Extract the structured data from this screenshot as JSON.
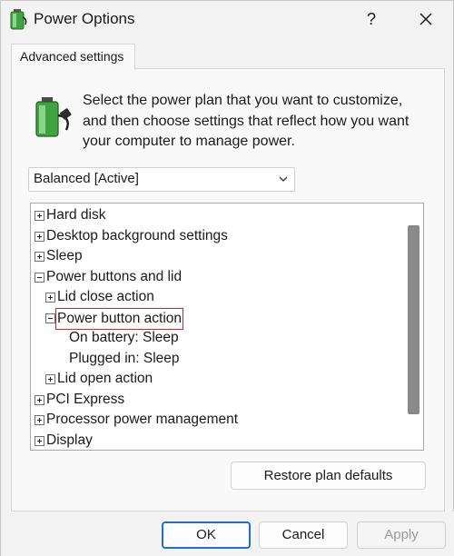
{
  "window": {
    "title": "Power Options",
    "help_label": "?"
  },
  "tab": {
    "label": "Advanced settings"
  },
  "description": "Select the power plan that you want to customize, and then choose settings that reflect how you want your computer to manage power.",
  "plan_select": {
    "value": "Balanced [Active]"
  },
  "tree": {
    "items": [
      {
        "label": "Hard disk",
        "expander": "+"
      },
      {
        "label": "Desktop background settings",
        "expander": "+"
      },
      {
        "label": "Sleep",
        "expander": "+"
      },
      {
        "label": "Power buttons and lid",
        "expander": "−"
      },
      {
        "label": "Lid close action",
        "expander": "+"
      },
      {
        "label": "Power button action",
        "expander": "−"
      },
      {
        "label": "On battery: Sleep"
      },
      {
        "label": "Plugged in: Sleep"
      },
      {
        "label": "Lid open action",
        "expander": "+"
      },
      {
        "label": "PCI Express",
        "expander": "+"
      },
      {
        "label": "Processor power management",
        "expander": "+"
      },
      {
        "label": "Display",
        "expander": "+"
      }
    ]
  },
  "buttons": {
    "restore": "Restore plan defaults",
    "ok": "OK",
    "cancel": "Cancel",
    "apply": "Apply"
  },
  "colors": {
    "highlight_box": "#d9232d",
    "ok_border": "#1f6fd1",
    "battery_green": "#3fa33f"
  }
}
